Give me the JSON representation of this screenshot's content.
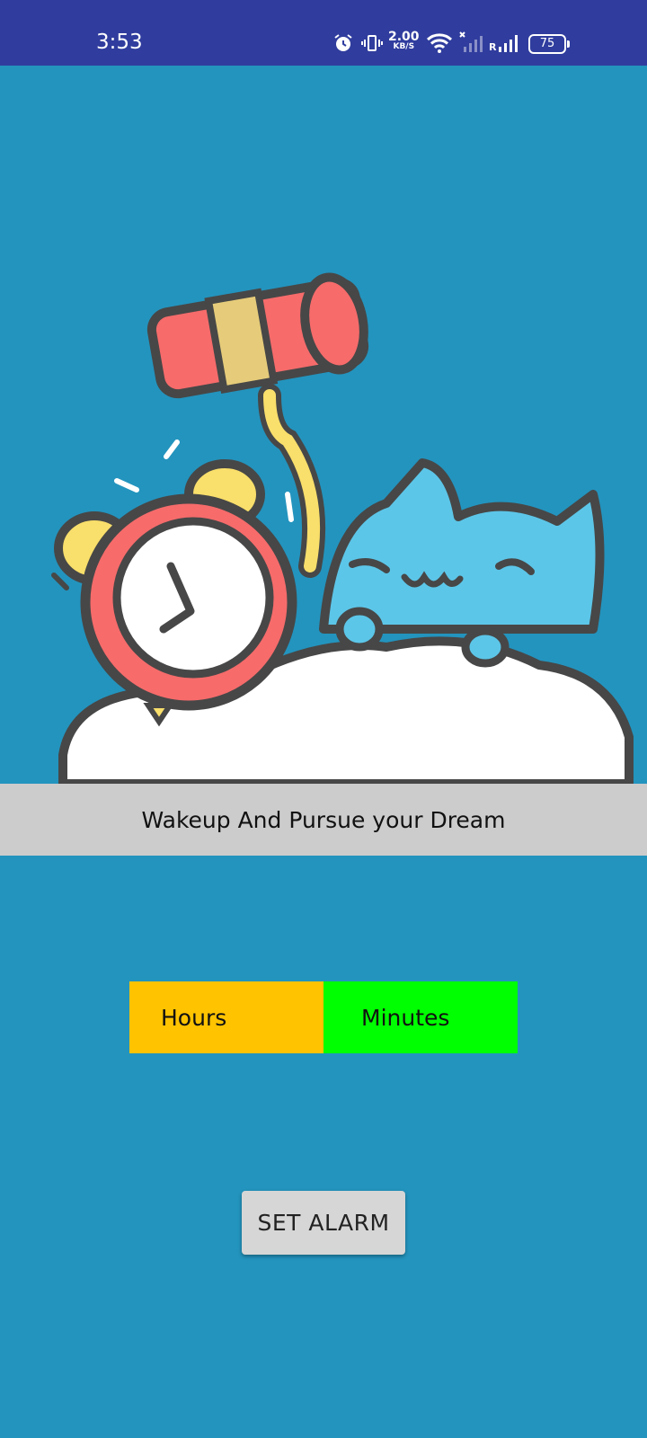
{
  "status_bar": {
    "time": "3:53",
    "net_speed_value": "2.00",
    "net_speed_unit": "KB/S",
    "roaming_label": "R",
    "battery_level": "75",
    "icons": [
      "alarm-icon",
      "vibrate-icon",
      "wifi-icon",
      "signal-off-icon",
      "signal-icon",
      "battery-icon"
    ]
  },
  "hero": {
    "illustration": "sleeping-cat-alarm-clock-hammer"
  },
  "motto": "Wakeup And Pursue your Dream",
  "time_inputs": {
    "hours_placeholder": "Hours",
    "minutes_placeholder": "Minutes"
  },
  "set_alarm_button": "SET ALARM",
  "colors": {
    "background": "#2394be",
    "status_bar": "#303d9e",
    "motto_bar": "#cccccc",
    "hours_field": "#ffc300",
    "minutes_field": "#00ff00",
    "button": "#d6d6d6"
  }
}
